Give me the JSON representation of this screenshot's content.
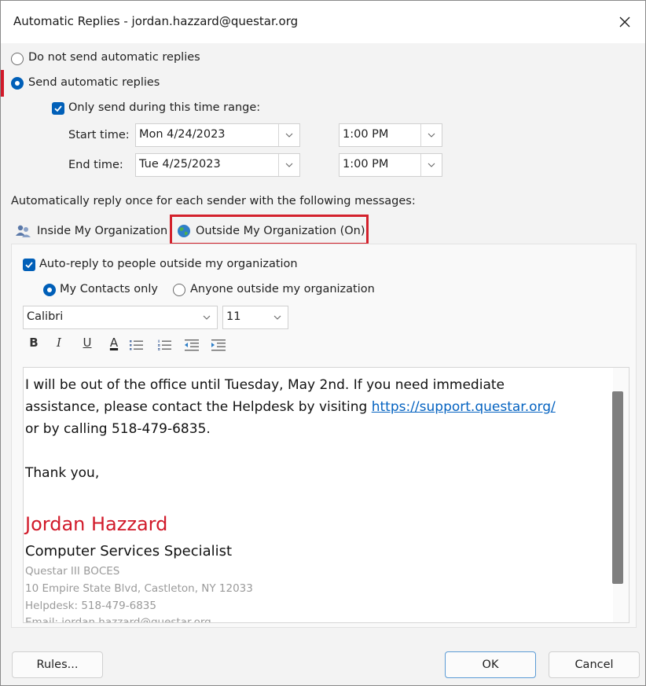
{
  "window": {
    "title": "Automatic Replies - jordan.hazzard@questar.org"
  },
  "reply_mode": {
    "off_label": "Do not send automatic replies",
    "on_label": "Send automatic replies",
    "selected": "on"
  },
  "time_range": {
    "checkbox_label": "Only send during this time range:",
    "checked": true,
    "start_label": "Start time:",
    "start_date": "Mon 4/24/2023",
    "start_time": "1:00 PM",
    "end_label": "End time:",
    "end_date": "Tue 4/25/2023",
    "end_time": "1:00 PM"
  },
  "instruction": "Automatically reply once for each sender with the following messages:",
  "tabs": {
    "inside": "Inside My Organization",
    "outside": "Outside My Organization (On)",
    "active": "outside"
  },
  "outside_panel": {
    "auto_reply_label": "Auto-reply to people outside my organization",
    "auto_reply_checked": true,
    "contacts_only_label": "My Contacts only",
    "anyone_label": "Anyone outside my organization",
    "audience_selected": "contacts"
  },
  "format": {
    "font": "Calibri",
    "size": "11",
    "bold": "B",
    "italic": "I",
    "underline": "U",
    "font_color": "A"
  },
  "message": {
    "line1": "I will be out of the office until Tuesday, May 2nd. If you need immediate",
    "line2_prefix": "assistance, please contact the Helpdesk by visiting ",
    "link": "https://support.questar.org/",
    "line3": "or by calling 518-479-6835.",
    "closing": "Thank you,",
    "signature_name": "Jordan Hazzard",
    "signature_title": "Computer Services Specialist",
    "org": "Questar III BOCES",
    "address": "10 Empire State Blvd, Castleton, NY 12033",
    "helpdesk": "Helpdesk: 518-479-6835",
    "email": "Email: jordan.hazzard@questar.org"
  },
  "buttons": {
    "rules": "Rules...",
    "ok": "OK",
    "cancel": "Cancel"
  },
  "colors": {
    "accent": "#005fb8",
    "highlight": "#d3212c",
    "signature": "#d11a2a",
    "link": "#0563c1"
  }
}
